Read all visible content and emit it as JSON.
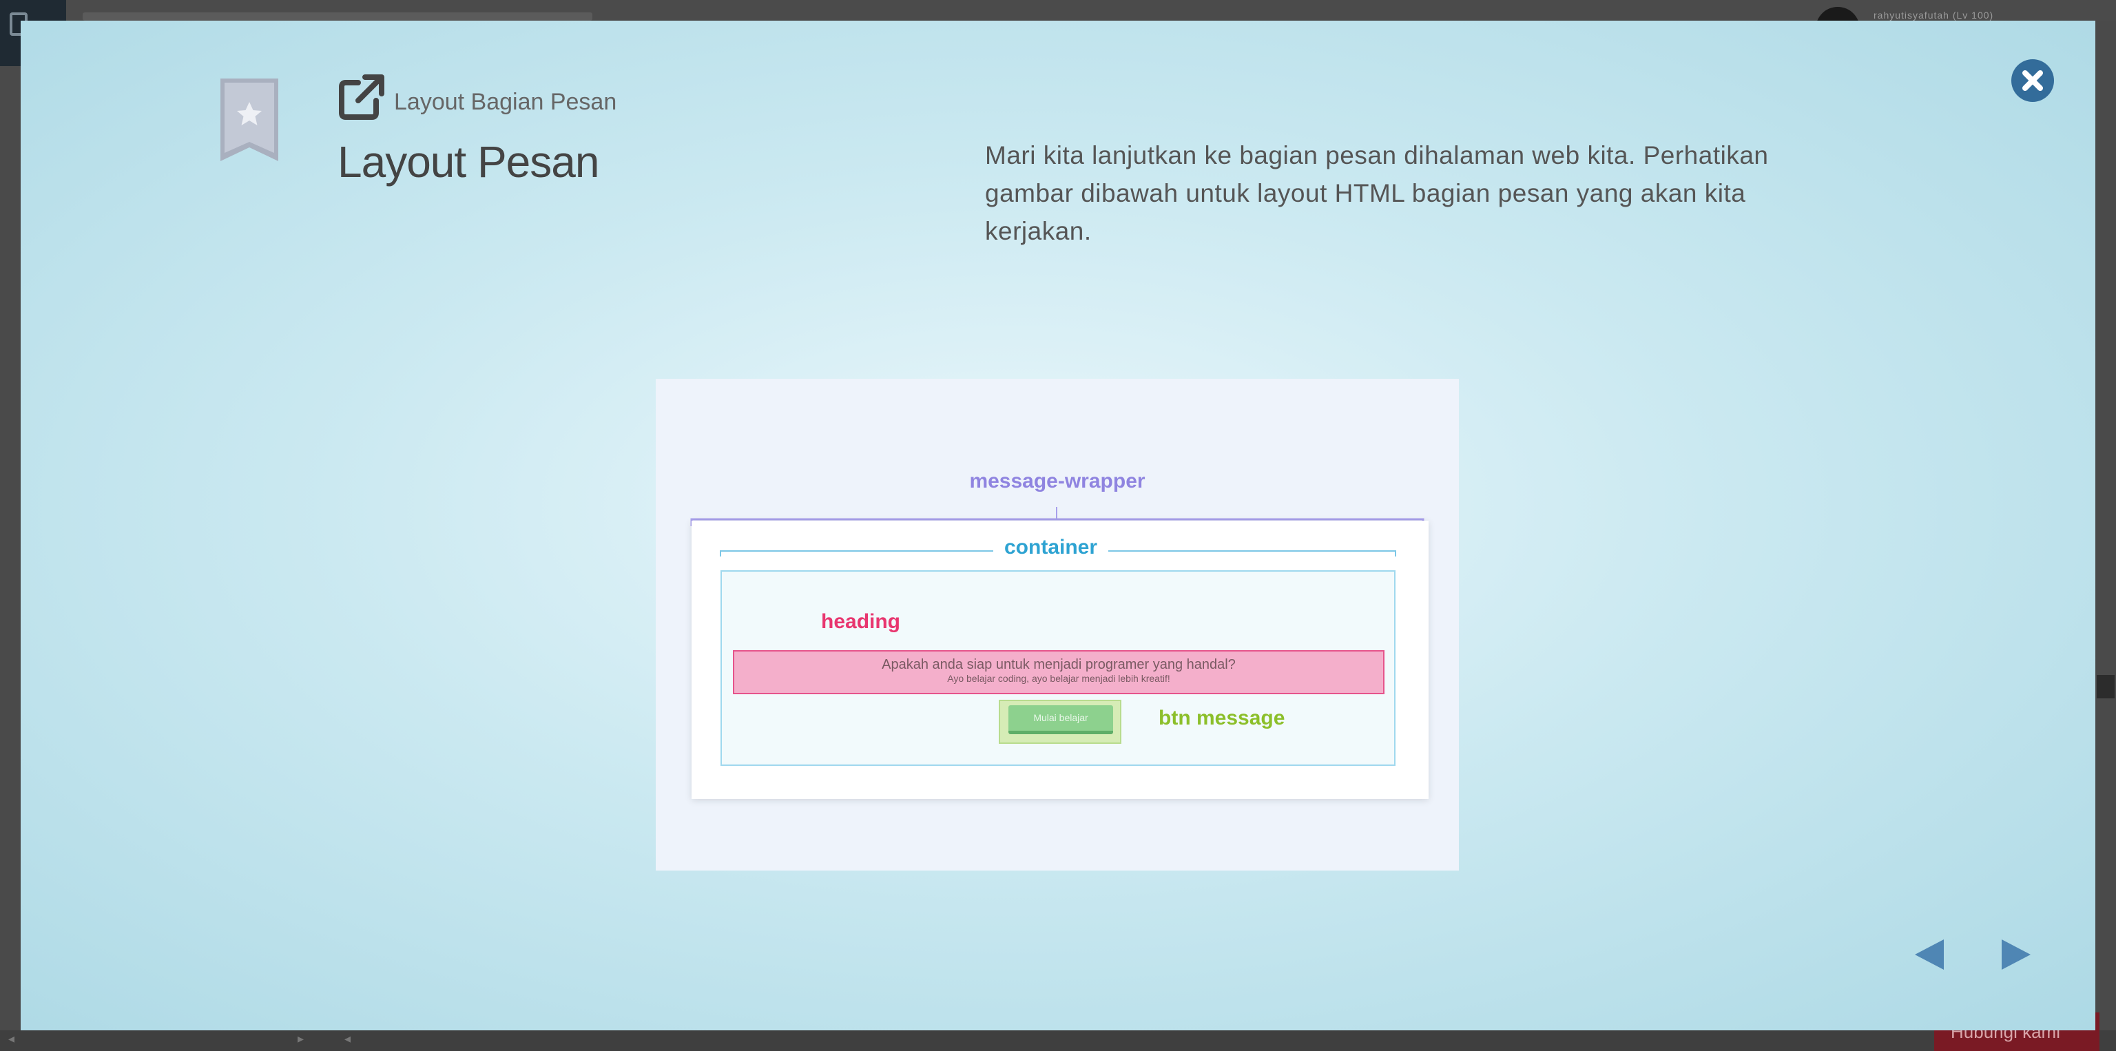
{
  "background": {
    "username": "rahyutisyafutah (Lv 100)",
    "bottom_button_label": "Hubungi kami"
  },
  "modal": {
    "subtitle": "Layout Bagian Pesan",
    "title": "Layout Pesan",
    "description": "Mari kita lanjutkan ke bagian pesan dihalaman web kita. Perhatikan gambar dibawah untuk layout HTML bagian pesan yang akan kita kerjakan.",
    "accent_color": "#336c9a"
  },
  "diagram": {
    "wrapper_label": "message-wrapper",
    "container_label": "container",
    "heading_label": "heading",
    "heading_line1": "Apakah anda siap untuk menjadi programer yang handal?",
    "heading_line2": "Ayo belajar coding, ayo belajar menjadi lebih kreatif!",
    "button_text": "Mulai belajar",
    "button_label": "btn message"
  }
}
